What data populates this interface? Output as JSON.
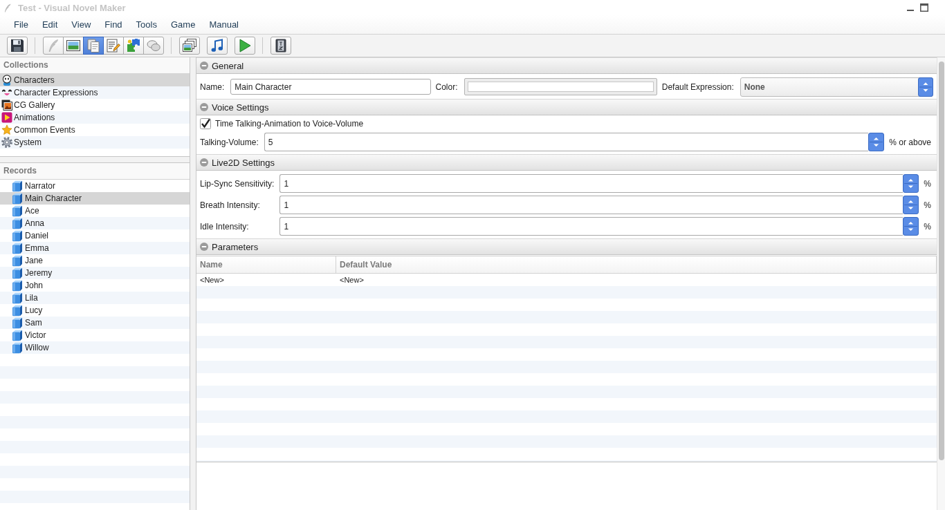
{
  "window": {
    "title": "Test - Visual Novel Maker"
  },
  "menu": [
    "File",
    "Edit",
    "View",
    "Find",
    "Tools",
    "Game",
    "Manual"
  ],
  "toolbar": {
    "groups": [
      {
        "segmented": false,
        "buttons": [
          {
            "selected": false
          }
        ]
      },
      {
        "segmented": true,
        "buttons": [
          {
            "selected": false
          },
          {
            "selected": false
          },
          {
            "selected": true
          },
          {
            "selected": false
          },
          {
            "selected": false
          },
          {
            "selected": false
          }
        ]
      },
      {
        "segmented": false,
        "buttons": [
          {
            "selected": false
          },
          {
            "selected": false
          },
          {
            "selected": false
          }
        ]
      },
      {
        "segmented": false,
        "buttons": [
          {
            "selected": false
          }
        ]
      }
    ]
  },
  "collections": {
    "title": "Collections",
    "items": [
      {
        "label": "Characters",
        "selected": true
      },
      {
        "label": "Character Expressions",
        "selected": false
      },
      {
        "label": "CG Gallery",
        "selected": false
      },
      {
        "label": "Animations",
        "selected": false
      },
      {
        "label": "Common Events",
        "selected": false
      },
      {
        "label": "System",
        "selected": false
      }
    ]
  },
  "records": {
    "title": "Records",
    "items": [
      {
        "label": "Narrator",
        "selected": false
      },
      {
        "label": "Main Character",
        "selected": true
      },
      {
        "label": "Ace",
        "selected": false
      },
      {
        "label": "Anna",
        "selected": false
      },
      {
        "label": "Daniel",
        "selected": false
      },
      {
        "label": "Emma",
        "selected": false
      },
      {
        "label": "Jane",
        "selected": false
      },
      {
        "label": "Jeremy",
        "selected": false
      },
      {
        "label": "John",
        "selected": false
      },
      {
        "label": "Lila",
        "selected": false
      },
      {
        "label": "Lucy",
        "selected": false
      },
      {
        "label": "Sam",
        "selected": false
      },
      {
        "label": "Victor",
        "selected": false
      },
      {
        "label": "Willow",
        "selected": false
      }
    ]
  },
  "sections": [
    {
      "title": "General",
      "expanded": true,
      "rows": [
        [
          {
            "kind": "text",
            "label": "Name:",
            "value": "Main Character"
          },
          {
            "kind": "color",
            "label": "Color:"
          },
          {
            "kind": "select",
            "label": "Default Expression:",
            "value": "None"
          }
        ]
      ]
    },
    {
      "title": "Voice Settings",
      "expanded": true,
      "rows": [
        [
          {
            "kind": "checkbox",
            "label": "Time Talking-Animation to Voice-Volume",
            "checked": true
          }
        ],
        [
          {
            "kind": "spin",
            "label": "Talking-Volume:",
            "value": "5",
            "suffix": "% or above"
          }
        ]
      ]
    },
    {
      "title": "Live2D Settings",
      "expanded": true,
      "rows": [
        [
          {
            "kind": "spin",
            "label": "Lip-Sync Sensitivity:",
            "value": "1",
            "suffix": "%"
          }
        ],
        [
          {
            "kind": "spin",
            "label": "Breath Intensity:",
            "value": "1",
            "suffix": "%"
          }
        ],
        [
          {
            "kind": "spin",
            "label": "Idle Intensity:",
            "value": "1",
            "suffix": "%"
          }
        ]
      ]
    },
    {
      "title": "Parameters",
      "expanded": true,
      "table": {
        "columns": [
          "Name",
          "Default Value"
        ],
        "rows": [
          [
            "<New>",
            "<New>"
          ]
        ]
      }
    }
  ]
}
